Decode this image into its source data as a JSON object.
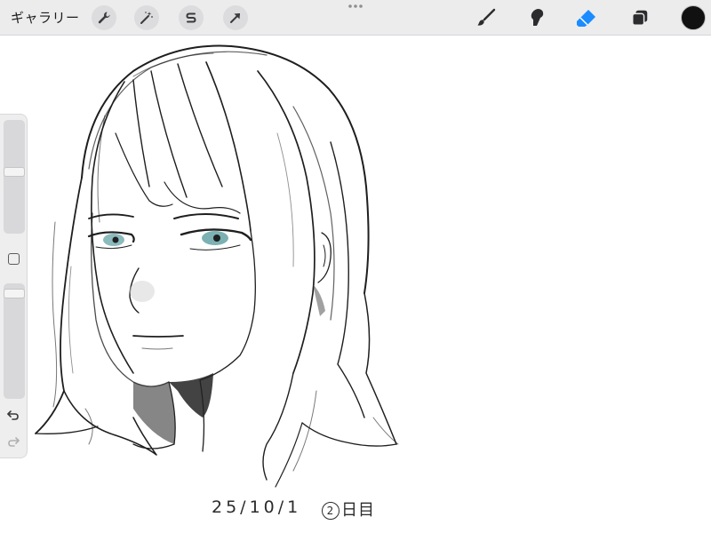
{
  "toolbar": {
    "gallery_label": "ギャラリー",
    "left_tools": [
      {
        "name": "actions",
        "icon": "wrench-icon"
      },
      {
        "name": "adjustments",
        "icon": "magic-wand-icon"
      },
      {
        "name": "selection",
        "icon": "selection-s-icon"
      },
      {
        "name": "transform",
        "icon": "arrow-cursor-icon"
      }
    ],
    "right_tools": [
      {
        "name": "brush",
        "icon": "brush-icon",
        "active": false
      },
      {
        "name": "smudge",
        "icon": "smudge-icon",
        "active": false
      },
      {
        "name": "eraser",
        "icon": "eraser-icon",
        "active": true
      },
      {
        "name": "layers",
        "icon": "layers-icon",
        "active": false
      }
    ],
    "current_color": "#111111",
    "accent_color": "#1a8cff"
  },
  "sidebar": {
    "brush_size_level": 0.55,
    "opacity_level": 0.95,
    "undo_icon": "undo-icon",
    "redo_icon": "redo-icon"
  },
  "canvas": {
    "date_text": "25/10/1",
    "day_number": "2",
    "day_suffix": "日目"
  }
}
